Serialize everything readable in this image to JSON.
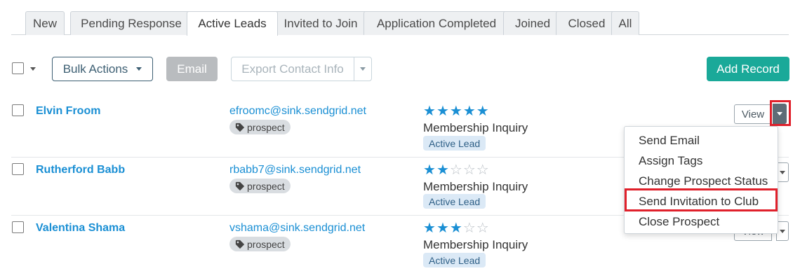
{
  "tabs": [
    {
      "label": "New"
    },
    {
      "label": "Pending Response"
    },
    {
      "label": "Active Leads",
      "active": true
    },
    {
      "label": "Invited to Join"
    },
    {
      "label": "Application Completed"
    },
    {
      "label": "Joined"
    },
    {
      "label": "Closed"
    },
    {
      "label": "All"
    }
  ],
  "toolbar": {
    "bulk_actions_label": "Bulk Actions",
    "email_label": "Email",
    "export_label": "Export Contact Info",
    "add_record_label": "Add Record"
  },
  "rows": [
    {
      "name": "Elvin Froom",
      "email": "efroomc@sink.sendgrid.net",
      "tag": "prospect",
      "rating": 5,
      "source": "Membership Inquiry",
      "status": "Active Lead",
      "view_label": "View"
    },
    {
      "name": "Rutherford Babb",
      "email": "rbabb7@sink.sendgrid.net",
      "tag": "prospect",
      "rating": 2,
      "source": "Membership Inquiry",
      "status": "Active Lead",
      "view_label": "View"
    },
    {
      "name": "Valentina Shama",
      "email": "vshama@sink.sendgrid.net",
      "tag": "prospect",
      "rating": 3,
      "source": "Membership Inquiry",
      "status": "Active Lead",
      "view_label": "View"
    }
  ],
  "rating_max": 5,
  "dropdown": {
    "items": [
      {
        "label": "Send Email"
      },
      {
        "label": "Assign Tags"
      },
      {
        "label": "Change Prospect Status"
      },
      {
        "label": "Send Invitation to Club",
        "highlighted": true
      },
      {
        "label": "Close Prospect"
      }
    ]
  },
  "colors": {
    "link": "#1a8fd4",
    "accent": "#1aa999",
    "highlight": "#e0202b"
  },
  "icons": {
    "tag": "tag-icon",
    "star_filled": "star-filled-icon",
    "star_empty": "star-empty-icon"
  }
}
